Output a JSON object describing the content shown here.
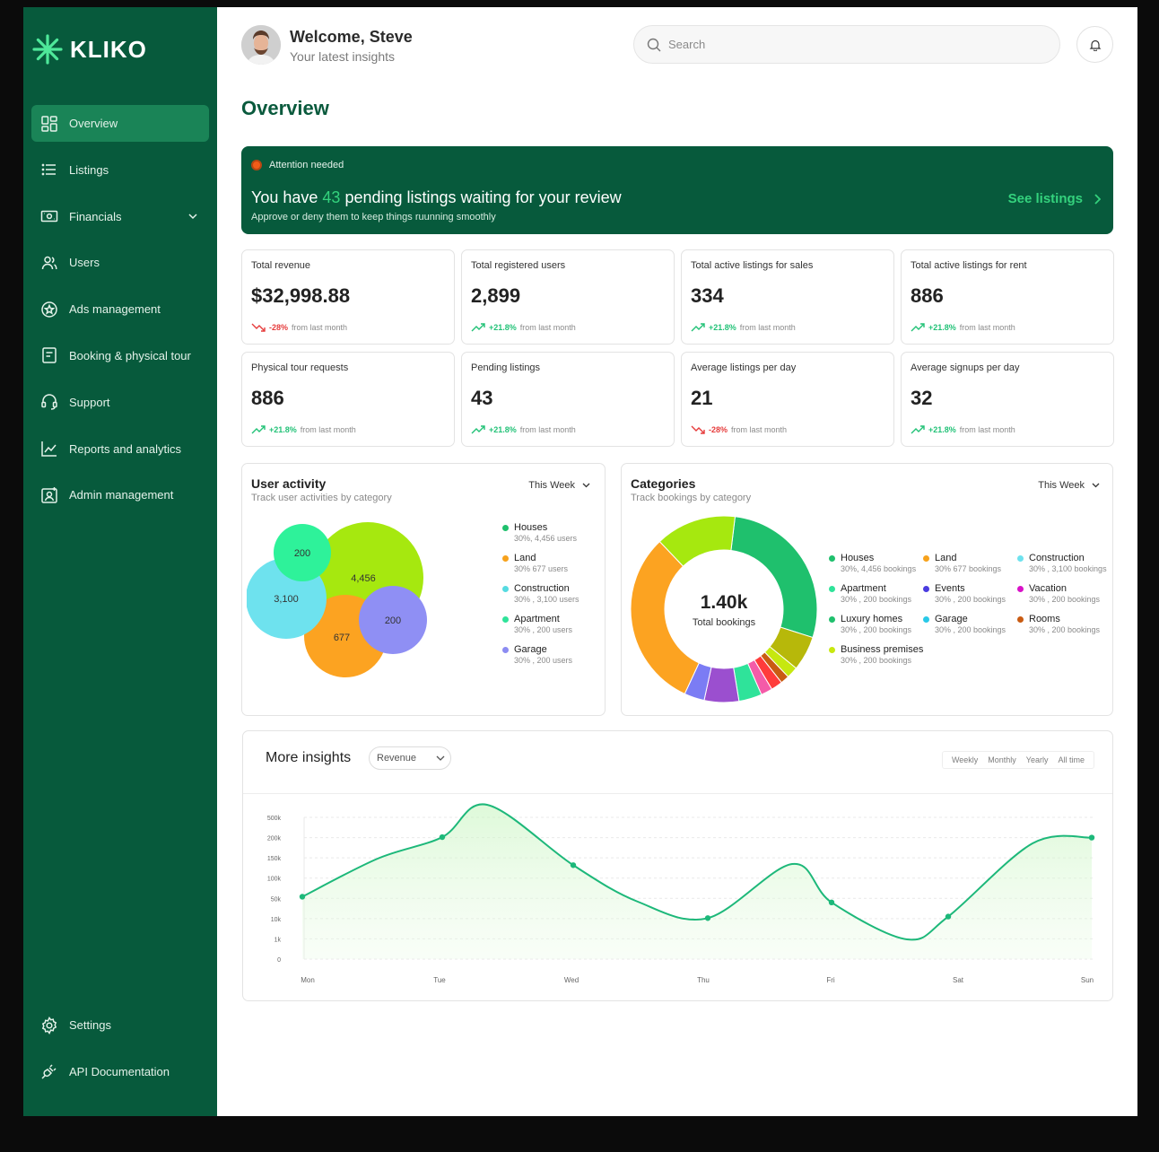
{
  "brand": {
    "name": "KLIKO"
  },
  "sidebar": {
    "items": [
      {
        "label": "Overview",
        "icon": "grid-icon",
        "active": true
      },
      {
        "label": "Listings",
        "icon": "list-icon"
      },
      {
        "label": "Financials",
        "icon": "money-icon",
        "has_dropdown": true
      },
      {
        "label": "Users",
        "icon": "users-icon"
      },
      {
        "label": "Ads management",
        "icon": "star-badge-icon"
      },
      {
        "label": "Booking & physical tour",
        "icon": "document-icon"
      },
      {
        "label": "Support",
        "icon": "headset-icon"
      },
      {
        "label": "Reports and analytics",
        "icon": "chart-icon"
      },
      {
        "label": "Admin management",
        "icon": "admin-icon"
      }
    ],
    "bottom": [
      {
        "label": "Settings",
        "icon": "gear-icon"
      },
      {
        "label": "API Documentation",
        "icon": "plug-icon"
      }
    ]
  },
  "header": {
    "welcome": "Welcome, Steve",
    "subtitle": "Your latest insights",
    "search_placeholder": "Search"
  },
  "page": {
    "title": "Overview"
  },
  "banner": {
    "tag": "Attention needed",
    "message_prefix": "You have ",
    "count": "43",
    "message_suffix": " pending listings waiting for your review",
    "sub": "Approve or deny them to keep things ruunning smoothly",
    "link": "See listings"
  },
  "stats": [
    {
      "label": "Total revenue",
      "value": "$32,998.88",
      "trend": "-28%",
      "direction": "down",
      "suffix": "from last month"
    },
    {
      "label": "Total registered users",
      "value": "2,899",
      "trend": "+21.8%",
      "direction": "up",
      "suffix": "from last month"
    },
    {
      "label": "Total active listings for sales",
      "value": "334",
      "trend": "+21.8%",
      "direction": "up",
      "suffix": "from last month"
    },
    {
      "label": "Total active listings for rent",
      "value": "886",
      "trend": "+21.8%",
      "direction": "up",
      "suffix": "from last month"
    },
    {
      "label": "Physical tour requests",
      "value": "886",
      "trend": "+21.8%",
      "direction": "up",
      "suffix": "from last month"
    },
    {
      "label": "Pending listings",
      "value": "43",
      "trend": "+21.8%",
      "direction": "up",
      "suffix": "from last month"
    },
    {
      "label": "Average listings per day",
      "value": "21",
      "trend": "-28%",
      "direction": "down",
      "suffix": "from last month"
    },
    {
      "label": "Average signups per day",
      "value": "32",
      "trend": "+21.8%",
      "direction": "up",
      "suffix": "from last month"
    }
  ],
  "user_activity": {
    "title": "User activity",
    "sub": "Track user activities by category",
    "period": "This Week",
    "bubbles": [
      {
        "label": "4,456",
        "color": "#a6e80f"
      },
      {
        "label": "677",
        "color": "#fca321"
      },
      {
        "label": "3,100",
        "color": "#6ee2ee"
      },
      {
        "label": "200",
        "color": "#2ef29a"
      },
      {
        "label": "200",
        "color": "#8f8ff4"
      }
    ],
    "legend": [
      {
        "name": "Houses",
        "detail": "30%, 4,456 users",
        "color": "#1fc06d"
      },
      {
        "name": "Land",
        "detail": "30%  677 users",
        "color": "#f7a21c"
      },
      {
        "name": "Construction",
        "detail": "30% , 3,100 users",
        "color": "#56dbe1"
      },
      {
        "name": "Apartment",
        "detail": "30% , 200 users",
        "color": "#2fe39a"
      },
      {
        "name": "Garage",
        "detail": "30% , 200 users",
        "color": "#8c8cf2"
      }
    ]
  },
  "categories": {
    "title": "Categories",
    "sub": "Track bookings by category",
    "period": "This Week",
    "center_value": "1.40k",
    "center_label": "Total bookings",
    "legend": [
      {
        "name": "Houses",
        "detail": "30%, 4,456 bookings",
        "color": "#1fc06d"
      },
      {
        "name": "Land",
        "detail": "30%  677 bookings",
        "color": "#f7a21c"
      },
      {
        "name": "Construction",
        "detail": "30% , 3,100 bookings",
        "color": "#6ee2ee"
      },
      {
        "name": "Apartment",
        "detail": "30% , 200 bookings",
        "color": "#2fe39a"
      },
      {
        "name": "Events",
        "detail": "30% , 200 bookings",
        "color": "#4a3ce0"
      },
      {
        "name": "Vacation",
        "detail": "30% , 200 bookings",
        "color": "#d912c8"
      },
      {
        "name": "Luxury homes",
        "detail": "30% , 200 bookings",
        "color": "#1fc06d"
      },
      {
        "name": "Garage",
        "detail": "30% , 200 bookings",
        "color": "#29c9e8"
      },
      {
        "name": "Rooms",
        "detail": "30% , 200 bookings",
        "color": "#c95c12"
      },
      {
        "name": "Business premises",
        "detail": "30% , 200 bookings",
        "color": "#c8e80f"
      }
    ],
    "donut_segments": [
      {
        "value": 28,
        "color": "#1fc06d"
      },
      {
        "value": 6,
        "color": "#b7b80a"
      },
      {
        "value": 2,
        "color": "#c6e80f"
      },
      {
        "value": 1.5,
        "color": "#c95c12"
      },
      {
        "value": 2,
        "color": "#ff3b3b"
      },
      {
        "value": 2,
        "color": "#f45ba8"
      },
      {
        "value": 4,
        "color": "#2fe39a"
      },
      {
        "value": 6,
        "color": "#9b4fcf"
      },
      {
        "value": 3.5,
        "color": "#7b7cf4"
      },
      {
        "value": 31,
        "color": "#fca321"
      },
      {
        "value": 14,
        "color": "#a6e80f"
      }
    ]
  },
  "insights": {
    "title": "More insights",
    "metric": "Revenue",
    "tabs": [
      "Weekly",
      "Monthly",
      "Yearly",
      "All time"
    ]
  },
  "chart_data": {
    "type": "line",
    "title": "",
    "xlabel": "",
    "ylabel": "",
    "categories": [
      "Mon",
      "Tue",
      "Wed",
      "Thu",
      "Fri",
      "Sat",
      "Sun"
    ],
    "y_ticks": [
      "0",
      "1k",
      "10k",
      "50k",
      "100k",
      "150k",
      "200k",
      "500k"
    ],
    "series": [
      {
        "values": [
          54,
          207,
          132,
          11,
          42,
          14,
          200
        ]
      }
    ],
    "grid": true,
    "color": "#1db87a"
  }
}
